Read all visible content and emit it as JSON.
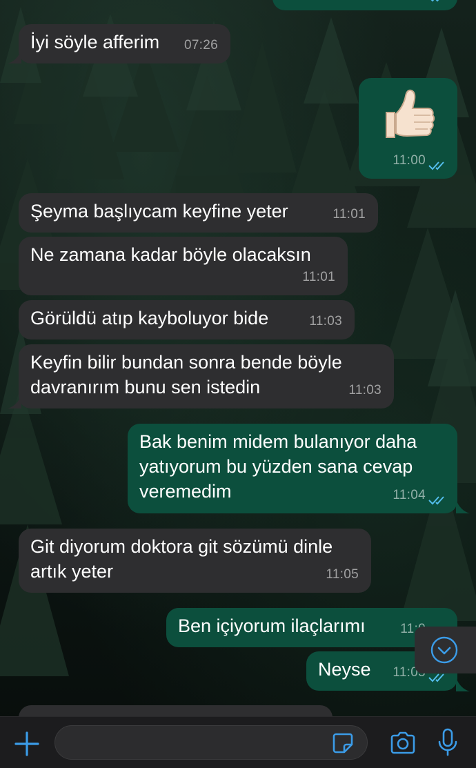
{
  "theme": {
    "incoming_bubble": "#2e2e30",
    "outgoing_bubble": "#0c4f3d",
    "accent": "#3b9ce8",
    "read_ticks": "#53bdeb"
  },
  "messages": [
    {
      "direction": "out",
      "text": "",
      "time": "",
      "status": "read",
      "partial": true
    },
    {
      "direction": "in",
      "text": "İyi söyle afferim",
      "time": "07:26"
    },
    {
      "direction": "out",
      "type": "emoji",
      "emoji": "thumbs-up-icon",
      "time": "11:00",
      "status": "read"
    },
    {
      "direction": "in",
      "text": "Şeyma başlıycam keyfine yeter",
      "time": "11:01"
    },
    {
      "direction": "in",
      "text": "Ne zamana kadar böyle olacaksın",
      "time": "11:01"
    },
    {
      "direction": "in",
      "text": "Görüldü atıp kayboluyor bide",
      "time": "11:03"
    },
    {
      "direction": "in",
      "text": "Keyfin bilir bundan sonra bende böyle\ndavranırım bunu sen istedin",
      "time": "11:03"
    },
    {
      "direction": "out",
      "text": "Bak benim midem bulanıyor daha\nyatıyorum bu yüzden sana cevap\nveremedim",
      "time": "11:04",
      "status": "read"
    },
    {
      "direction": "in",
      "text": "Git diyorum doktora git sözümü dinle\nartık yeter",
      "time": "11:05"
    },
    {
      "direction": "out",
      "text": "Ben içiyorum ilaçlarımı",
      "time": "11:0",
      "status": "read"
    },
    {
      "direction": "out",
      "text": "Neyse",
      "time": "11:05",
      "status": "read"
    },
    {
      "direction": "in",
      "text": "",
      "time": "",
      "partial": true
    }
  ],
  "composer": {
    "placeholder": "",
    "value": "",
    "icons": [
      "plus-icon",
      "sticker-icon",
      "camera-icon",
      "microphone-icon"
    ]
  },
  "scroll_button": {
    "icon": "chevron-down-icon"
  }
}
